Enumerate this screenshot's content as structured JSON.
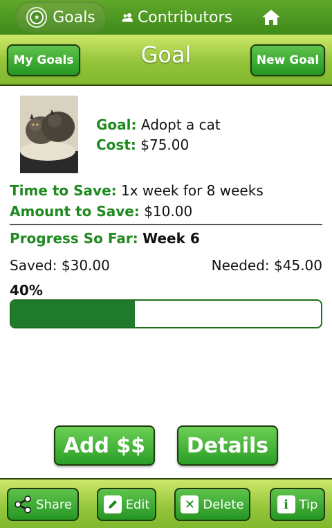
{
  "nav": {
    "goals_label": "Goals",
    "contributors_label": "Contributors",
    "home_icon": "home-icon"
  },
  "header": {
    "title": "Goal",
    "my_goals_label": "My Goals",
    "new_goal_label": "New Goal"
  },
  "goal": {
    "goal_label": "Goal:",
    "goal_value": "Adopt a cat",
    "cost_label": "Cost:",
    "cost_value": "$75.00",
    "time_label": "Time to Save:",
    "time_value": "1x week for 8 weeks",
    "amount_label": "Amount to Save:",
    "amount_value": "$10.00"
  },
  "progress": {
    "label": "Progress So Far:",
    "week": "Week 6",
    "saved_text": "Saved: $30.00",
    "needed_text": "Needed: $45.00",
    "percent_text": "40%",
    "fraction": 0.4
  },
  "actions": {
    "add_label": "Add $$",
    "details_label": "Details"
  },
  "bottom": {
    "share_label": "Share",
    "edit_label": "Edit",
    "delete_label": "Delete",
    "tip_label": "Tip"
  },
  "colors": {
    "brand_green": "#1f8a1f",
    "bar_green": "#1f7a2b",
    "header_lime": "#93c43a"
  }
}
